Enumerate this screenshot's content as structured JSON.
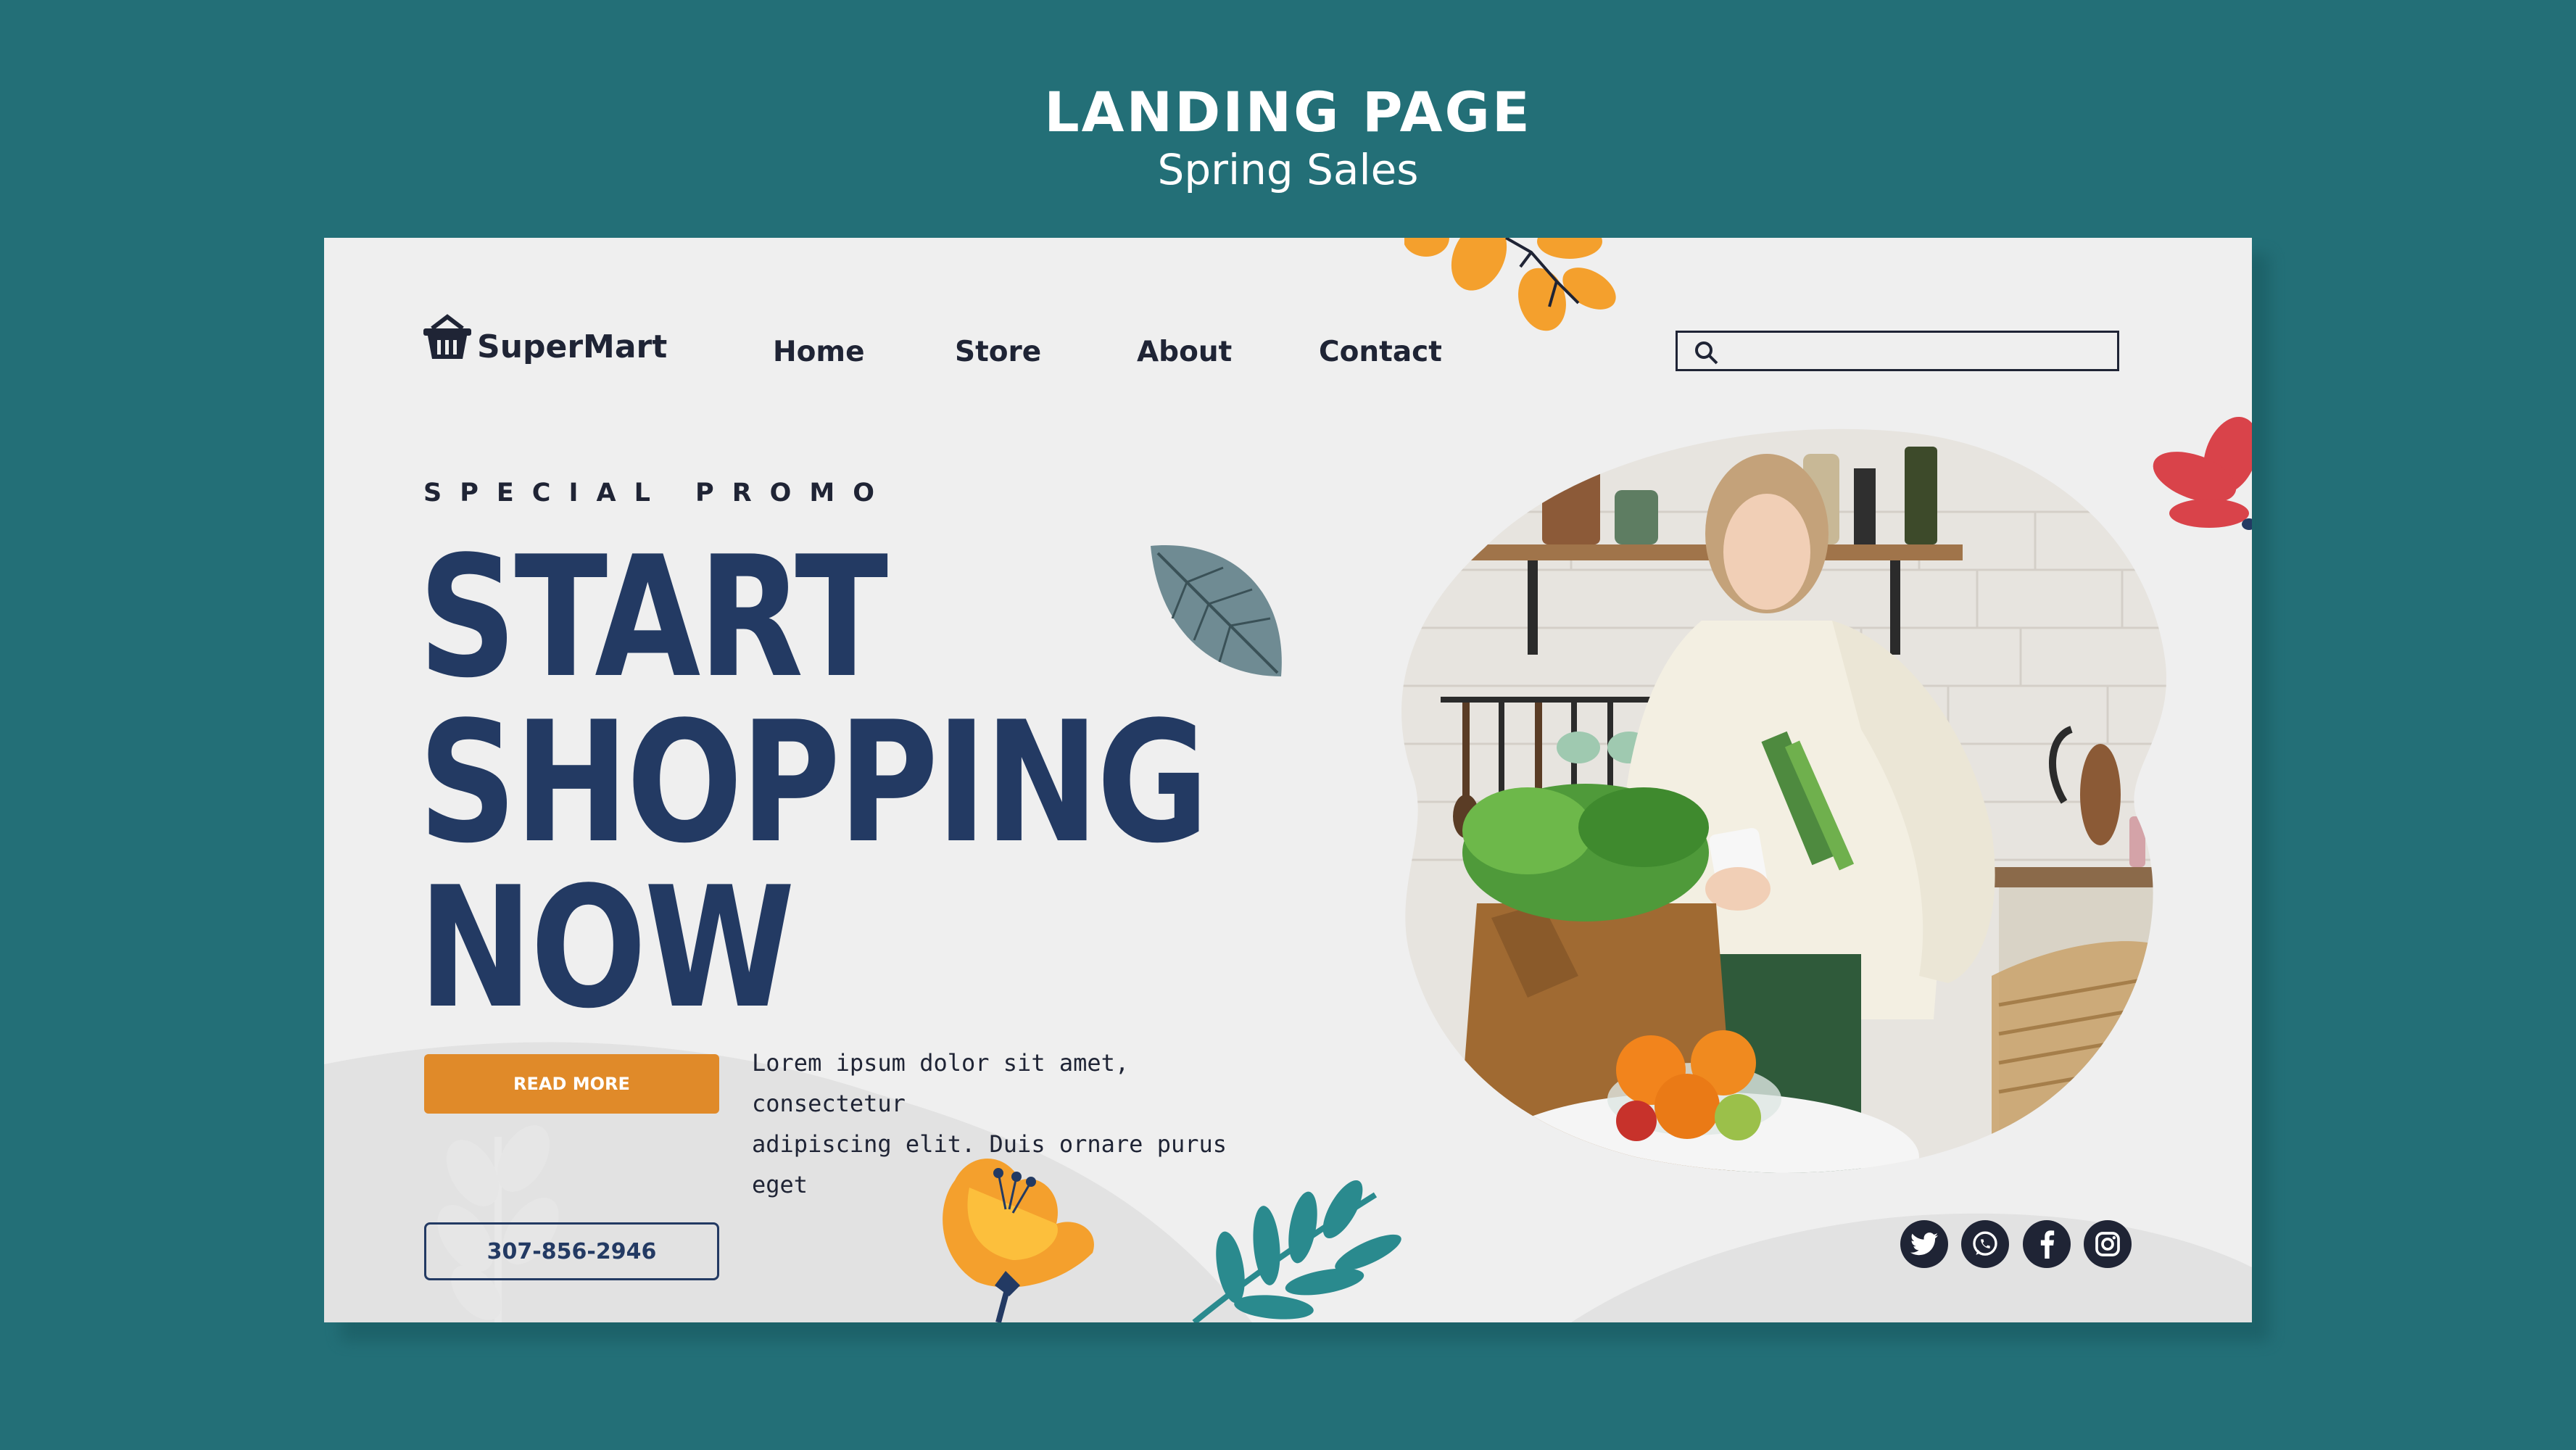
{
  "page": {
    "title": "LANDING PAGE",
    "subtitle": "Spring Sales"
  },
  "brand": {
    "name": "SuperMart"
  },
  "nav": {
    "items": [
      {
        "label": "Home"
      },
      {
        "label": "Store"
      },
      {
        "label": "About"
      },
      {
        "label": "Contact"
      }
    ]
  },
  "search": {
    "placeholder": ""
  },
  "hero": {
    "promo_label": "SPECIAL PROMO",
    "headline_lines": [
      "START",
      "SHOPPING",
      "NOW"
    ],
    "description_lines": [
      "Lorem ipsum dolor sit amet, consectetur",
      "adipiscing elit. Duis ornare purus eget"
    ],
    "cta_label": "READ MORE",
    "phone": "307-856-2946"
  },
  "social": {
    "icons": [
      "twitter-icon",
      "whatsapp-icon",
      "facebook-icon",
      "instagram-icon"
    ]
  },
  "colors": {
    "background": "#236f77",
    "card": "#efefef",
    "navy": "#233a63",
    "accent_orange": "#e08a29",
    "dark_text": "#1f2435",
    "teal_leaf": "#2a8a8e",
    "coral": "#d9434a"
  }
}
